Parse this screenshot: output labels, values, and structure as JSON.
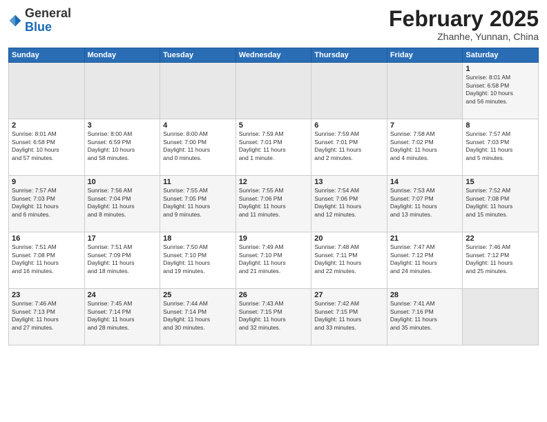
{
  "logo": {
    "general": "General",
    "blue": "Blue"
  },
  "header": {
    "month": "February 2025",
    "location": "Zhanhe, Yunnan, China"
  },
  "weekdays": [
    "Sunday",
    "Monday",
    "Tuesday",
    "Wednesday",
    "Thursday",
    "Friday",
    "Saturday"
  ],
  "weeks": [
    [
      {
        "day": "",
        "info": ""
      },
      {
        "day": "",
        "info": ""
      },
      {
        "day": "",
        "info": ""
      },
      {
        "day": "",
        "info": ""
      },
      {
        "day": "",
        "info": ""
      },
      {
        "day": "",
        "info": ""
      },
      {
        "day": "1",
        "info": "Sunrise: 8:01 AM\nSunset: 6:58 PM\nDaylight: 10 hours\nand 56 minutes."
      }
    ],
    [
      {
        "day": "2",
        "info": "Sunrise: 8:01 AM\nSunset: 6:58 PM\nDaylight: 10 hours\nand 57 minutes."
      },
      {
        "day": "3",
        "info": "Sunrise: 8:00 AM\nSunset: 6:59 PM\nDaylight: 10 hours\nand 58 minutes."
      },
      {
        "day": "4",
        "info": "Sunrise: 8:00 AM\nSunset: 7:00 PM\nDaylight: 11 hours\nand 0 minutes."
      },
      {
        "day": "5",
        "info": "Sunrise: 7:59 AM\nSunset: 7:01 PM\nDaylight: 11 hours\nand 1 minute."
      },
      {
        "day": "6",
        "info": "Sunrise: 7:59 AM\nSunset: 7:01 PM\nDaylight: 11 hours\nand 2 minutes."
      },
      {
        "day": "7",
        "info": "Sunrise: 7:58 AM\nSunset: 7:02 PM\nDaylight: 11 hours\nand 4 minutes."
      },
      {
        "day": "8",
        "info": "Sunrise: 7:57 AM\nSunset: 7:03 PM\nDaylight: 11 hours\nand 5 minutes."
      }
    ],
    [
      {
        "day": "9",
        "info": "Sunrise: 7:57 AM\nSunset: 7:03 PM\nDaylight: 11 hours\nand 6 minutes."
      },
      {
        "day": "10",
        "info": "Sunrise: 7:56 AM\nSunset: 7:04 PM\nDaylight: 11 hours\nand 8 minutes."
      },
      {
        "day": "11",
        "info": "Sunrise: 7:55 AM\nSunset: 7:05 PM\nDaylight: 11 hours\nand 9 minutes."
      },
      {
        "day": "12",
        "info": "Sunrise: 7:55 AM\nSunset: 7:06 PM\nDaylight: 11 hours\nand 11 minutes."
      },
      {
        "day": "13",
        "info": "Sunrise: 7:54 AM\nSunset: 7:06 PM\nDaylight: 11 hours\nand 12 minutes."
      },
      {
        "day": "14",
        "info": "Sunrise: 7:53 AM\nSunset: 7:07 PM\nDaylight: 11 hours\nand 13 minutes."
      },
      {
        "day": "15",
        "info": "Sunrise: 7:52 AM\nSunset: 7:08 PM\nDaylight: 11 hours\nand 15 minutes."
      }
    ],
    [
      {
        "day": "16",
        "info": "Sunrise: 7:51 AM\nSunset: 7:08 PM\nDaylight: 11 hours\nand 16 minutes."
      },
      {
        "day": "17",
        "info": "Sunrise: 7:51 AM\nSunset: 7:09 PM\nDaylight: 11 hours\nand 18 minutes."
      },
      {
        "day": "18",
        "info": "Sunrise: 7:50 AM\nSunset: 7:10 PM\nDaylight: 11 hours\nand 19 minutes."
      },
      {
        "day": "19",
        "info": "Sunrise: 7:49 AM\nSunset: 7:10 PM\nDaylight: 11 hours\nand 21 minutes."
      },
      {
        "day": "20",
        "info": "Sunrise: 7:48 AM\nSunset: 7:11 PM\nDaylight: 11 hours\nand 22 minutes."
      },
      {
        "day": "21",
        "info": "Sunrise: 7:47 AM\nSunset: 7:12 PM\nDaylight: 11 hours\nand 24 minutes."
      },
      {
        "day": "22",
        "info": "Sunrise: 7:46 AM\nSunset: 7:12 PM\nDaylight: 11 hours\nand 25 minutes."
      }
    ],
    [
      {
        "day": "23",
        "info": "Sunrise: 7:46 AM\nSunset: 7:13 PM\nDaylight: 11 hours\nand 27 minutes."
      },
      {
        "day": "24",
        "info": "Sunrise: 7:45 AM\nSunset: 7:14 PM\nDaylight: 11 hours\nand 28 minutes."
      },
      {
        "day": "25",
        "info": "Sunrise: 7:44 AM\nSunset: 7:14 PM\nDaylight: 11 hours\nand 30 minutes."
      },
      {
        "day": "26",
        "info": "Sunrise: 7:43 AM\nSunset: 7:15 PM\nDaylight: 11 hours\nand 32 minutes."
      },
      {
        "day": "27",
        "info": "Sunrise: 7:42 AM\nSunset: 7:15 PM\nDaylight: 11 hours\nand 33 minutes."
      },
      {
        "day": "28",
        "info": "Sunrise: 7:41 AM\nSunset: 7:16 PM\nDaylight: 11 hours\nand 35 minutes."
      },
      {
        "day": "",
        "info": ""
      }
    ]
  ]
}
